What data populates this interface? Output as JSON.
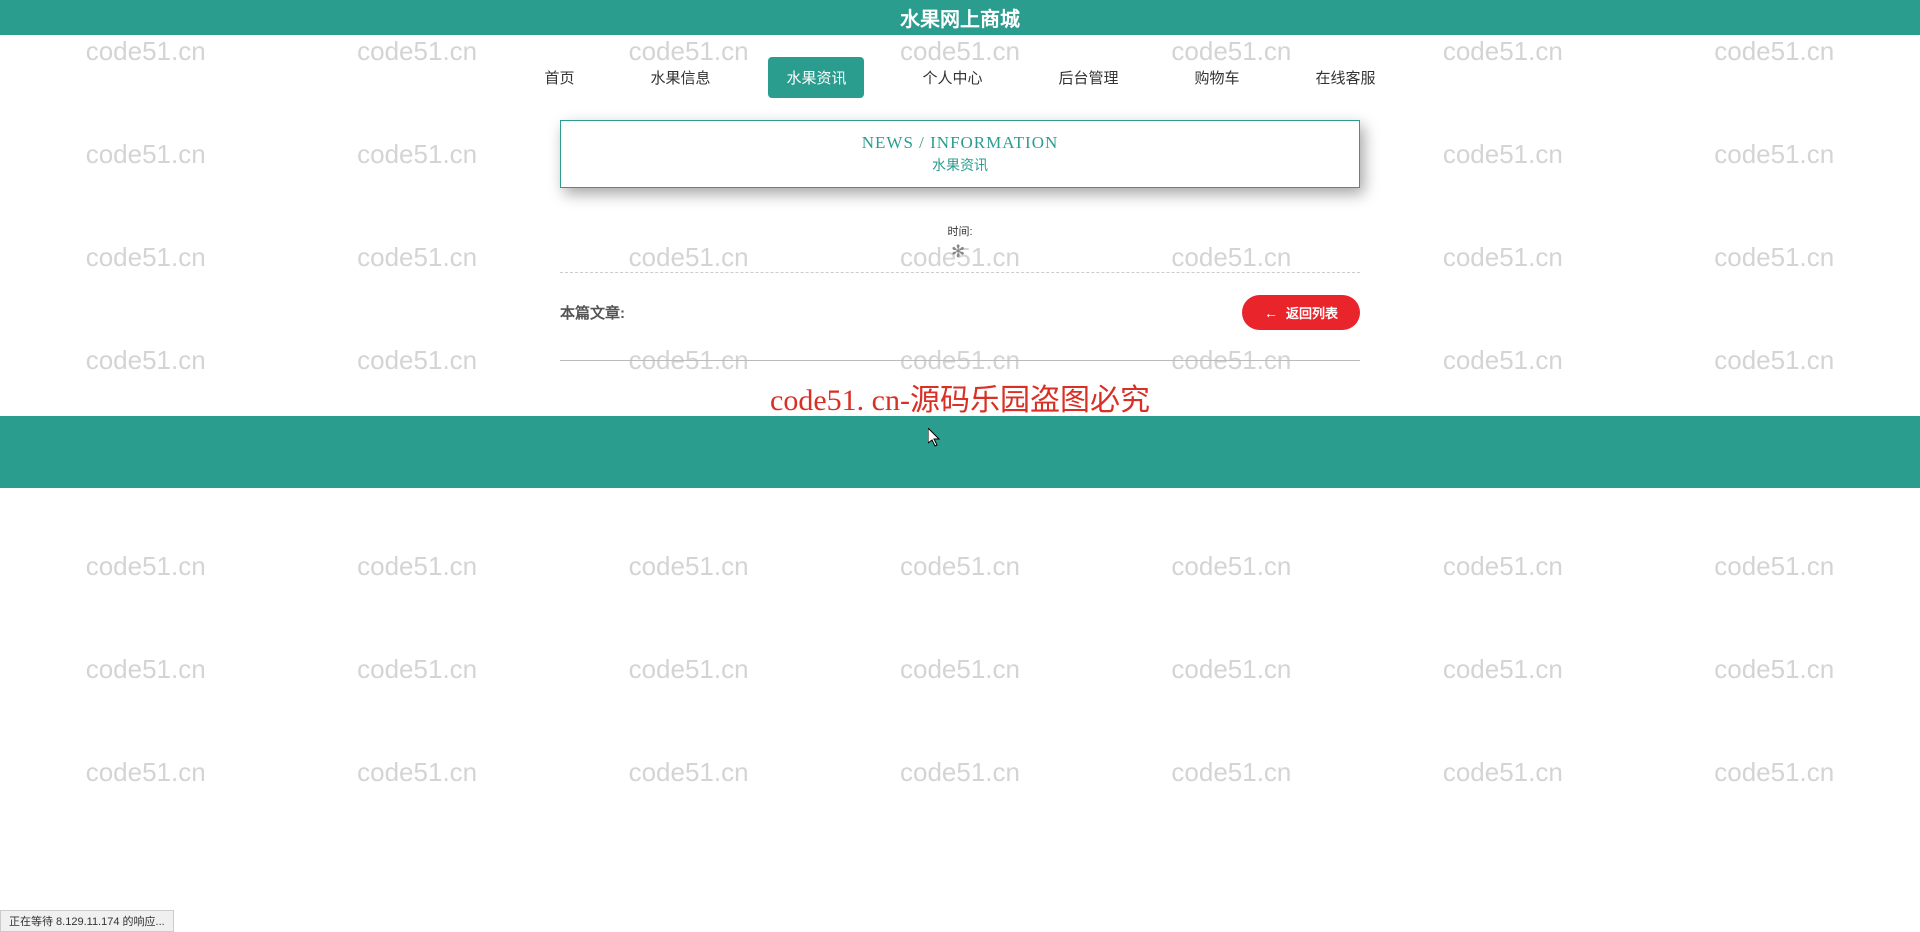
{
  "header": {
    "title": "水果网上商城"
  },
  "nav": {
    "items": [
      {
        "label": "首页",
        "active": false
      },
      {
        "label": "水果信息",
        "active": false
      },
      {
        "label": "水果资讯",
        "active": true
      },
      {
        "label": "个人中心",
        "active": false
      },
      {
        "label": "后台管理",
        "active": false
      },
      {
        "label": "购物车",
        "active": false
      },
      {
        "label": "在线客服",
        "active": false
      }
    ]
  },
  "info_card": {
    "title_en": "NEWS / INFORMATION",
    "title_cn": "水果资讯"
  },
  "time": {
    "label": "时间:"
  },
  "article": {
    "label": "本篇文章:"
  },
  "back_button": {
    "label": "返回列表"
  },
  "overlay": {
    "text": "code51. cn-源码乐园盗图必究"
  },
  "watermark": {
    "text": "code51.cn"
  },
  "status": {
    "text": "正在等待 8.129.11.174 的响应..."
  }
}
